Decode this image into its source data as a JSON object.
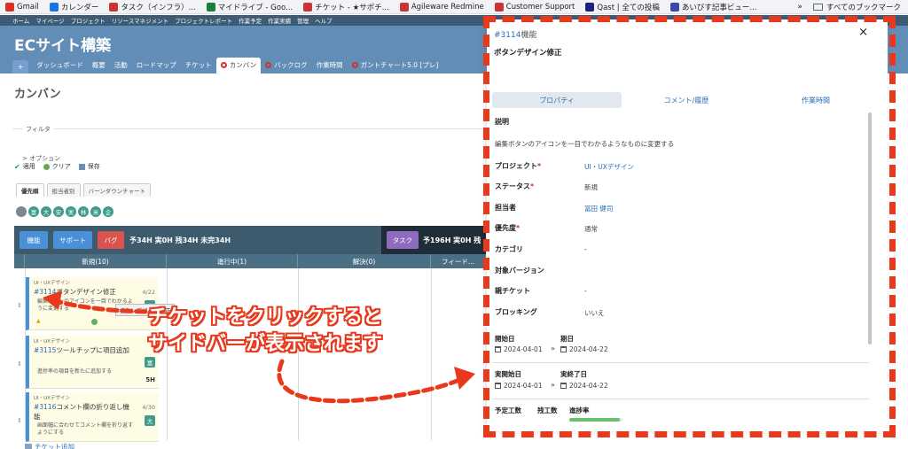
{
  "bookmarks": {
    "items": [
      {
        "label": "Gmail",
        "color": "#d93025"
      },
      {
        "label": "カレンダー",
        "color": "#1a73e8"
      },
      {
        "label": "タスク（インフラ）...",
        "color": "#c33"
      },
      {
        "label": "マイドライブ - Goo...",
        "color": "#188038"
      },
      {
        "label": "チケット - ★サポチ...",
        "color": "#c33"
      },
      {
        "label": "Agileware Redmine",
        "color": "#c33"
      },
      {
        "label": "Customer Support",
        "color": "#c33"
      },
      {
        "label": "Qast | 全ての投稿",
        "color": "#1a237e"
      },
      {
        "label": "あいびす記事ビュー...",
        "color": "#3949ab"
      }
    ],
    "more": "»",
    "folder": "すべてのブックマーク"
  },
  "redmine": {
    "top_menu": [
      "ホーム",
      "マイページ",
      "プロジェクト",
      "リソースマネジメント",
      "プロジェクトレポート",
      "作業予定",
      "作業実績",
      "管理",
      "ヘルプ"
    ],
    "project_title": "ECサイト構築",
    "tabs": [
      {
        "label": "+"
      },
      {
        "label": "ダッシュボード"
      },
      {
        "label": "概要"
      },
      {
        "label": "活動"
      },
      {
        "label": "ロードマップ"
      },
      {
        "label": "チケット"
      },
      {
        "label": "カンバン"
      },
      {
        "label": "バックログ"
      },
      {
        "label": "作業時間"
      },
      {
        "label": "ガントチャート5.0 [プレ]"
      }
    ],
    "page_heading": "カンバン",
    "filter_label": "フィルタ",
    "options_label": "> オプション",
    "actions": {
      "apply": "適用",
      "clear": "クリア",
      "save": "保存"
    },
    "sub_tabs": [
      "優先順",
      "担当者別",
      "バーンダウンチャート"
    ],
    "avatars": [
      "富",
      "大",
      "安",
      "実",
      "林",
      "米",
      "企"
    ],
    "tracker_buttons": [
      {
        "label": "機能",
        "color": "#4a90d9"
      },
      {
        "label": "サポート",
        "color": "#4a90d9"
      },
      {
        "label": "バグ",
        "color": "#d9534f"
      }
    ],
    "tracker_summary": "予34H 実0H 残34H 未完34H",
    "task_button": {
      "label": "タスク",
      "color": "#8e6bbf"
    },
    "task_summary": "予196H 実0H 残",
    "columns": [
      "新規(10)",
      "進行中(1)",
      "解決(0)",
      "フィード..."
    ],
    "cards": [
      {
        "project": "UI・UXデザイン",
        "id": "#3114",
        "title": "ボタンデザイン修正",
        "date": "4/22",
        "desc": "編集ボタンのアイコンを一目でわかるように変更する",
        "badge": "富",
        "hours": ""
      },
      {
        "project": "UI・UXデザイン",
        "id": "#3115",
        "title": "ツールチップに項目追加",
        "date": "",
        "desc": "進捗率の項目を新たに追加する",
        "badge": "富",
        "hours": "5H"
      },
      {
        "project": "UI・UXデザイン",
        "id": "#3116",
        "title": "コメント欄の折り返し機能",
        "date": "4/30",
        "desc": "画面幅に合わせてコメント欄を折り返すようにする",
        "badge": "大",
        "hours": ""
      }
    ],
    "tooltip": "ボタンデザイン修正",
    "add_ticket": "チケット追加"
  },
  "annotation": {
    "line1": "チケットをクリックすると",
    "line2": "サイドバーが表示されます",
    "color": "#e8391d"
  },
  "panel": {
    "issue_id": "#3114",
    "issue_tail": "機能",
    "close": "×",
    "title": "ボタンデザイン修正",
    "tabs": [
      "プロパティ",
      "コメント/履歴",
      "作業時間"
    ],
    "description_heading": "説明",
    "description": "編集ボタンのアイコンを一目でわかるようなものに変更する",
    "fields": [
      {
        "label": "プロジェクト",
        "required": "*",
        "value": "UI・UXデザイン",
        "link": true
      },
      {
        "label": "ステータス",
        "required": "*",
        "value": "新規",
        "link": false
      },
      {
        "label": "担当者",
        "required": "",
        "value": "冨田 健司",
        "link": true
      },
      {
        "label": "優先度",
        "required": "*",
        "value": "通常",
        "link": false
      },
      {
        "label": "カテゴリ",
        "required": "",
        "value": "-",
        "link": false
      },
      {
        "label": "対象バージョン",
        "required": "",
        "value": "",
        "link": false
      },
      {
        "label": "親チケット",
        "required": "",
        "value": "-",
        "link": false
      },
      {
        "label": "ブロッキング",
        "required": "",
        "value": "いいえ",
        "link": false
      }
    ],
    "start_label": "開始日",
    "due_label": "期日",
    "start_date": "2024-04-01",
    "due_date": "2024-04-22",
    "actual_start_label": "実開始日",
    "actual_end_label": "実終了日",
    "actual_start": "2024-04-01",
    "actual_end": "2024-04-22",
    "sep": "»",
    "effort_labels": [
      "予定工数",
      "残工数",
      "進捗率"
    ],
    "progress": 0.95
  }
}
